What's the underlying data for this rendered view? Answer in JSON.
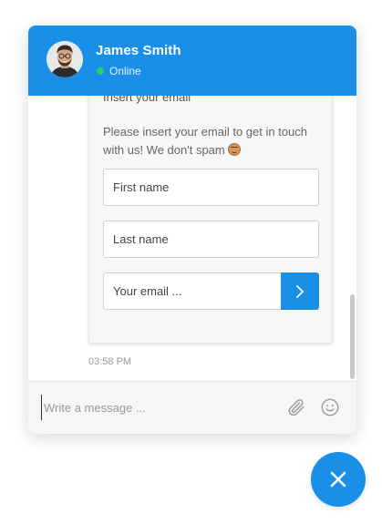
{
  "header": {
    "agent_name": "James Smith",
    "status": "Online",
    "status_color": "#2ecc71",
    "background_color": "#1a8fe8",
    "avatar_icon": "avatar-man-icon"
  },
  "form_card": {
    "title": "Insert your email",
    "description": "Please insert your email to get in touch with us! We don't spam",
    "description_emoji": "smiling-face-emoji",
    "first_name_placeholder": "First name",
    "first_name_value": "",
    "last_name_placeholder": "Last name",
    "last_name_value": "",
    "email_placeholder": "Your email ...",
    "email_value": "",
    "submit_icon": "chevron-right-icon"
  },
  "message": {
    "timestamp": "03:58 PM"
  },
  "composer": {
    "placeholder": "Write a message ...",
    "value": "",
    "attach_icon": "paperclip-icon",
    "emoji_icon": "smiley-icon"
  },
  "launcher": {
    "icon": "close-icon",
    "color": "#1a8fe8"
  }
}
